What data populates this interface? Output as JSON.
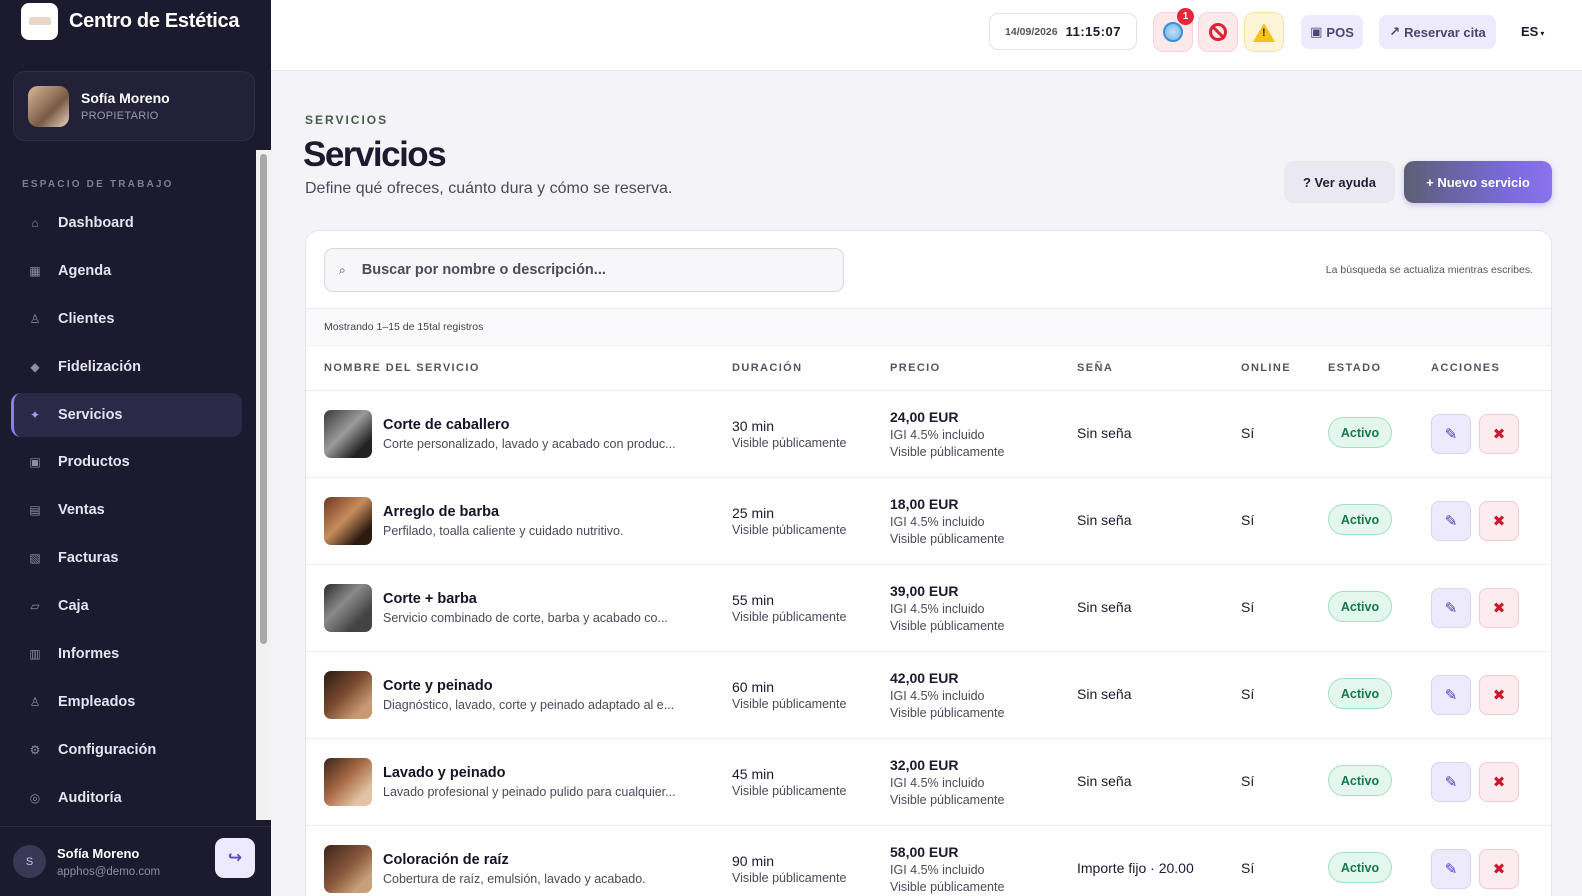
{
  "sidebar": {
    "brand": "Centro de Estética",
    "profile": {
      "name": "Sofía Moreno",
      "role": "PROPIETARIO"
    },
    "caption": "ESPACIO DE TRABAJO",
    "items": [
      {
        "label": "Dashboard",
        "icon": "⌂"
      },
      {
        "label": "Agenda",
        "icon": "▦"
      },
      {
        "label": "Clientes",
        "icon": "♙"
      },
      {
        "label": "Fidelización",
        "icon": "◆"
      },
      {
        "label": "Servicios",
        "icon": "✦"
      },
      {
        "label": "Productos",
        "icon": "▣"
      },
      {
        "label": "Ventas",
        "icon": "▤"
      },
      {
        "label": "Facturas",
        "icon": "▧"
      },
      {
        "label": "Caja",
        "icon": "▱"
      },
      {
        "label": "Informes",
        "icon": "▥"
      },
      {
        "label": "Empleados",
        "icon": "♙"
      },
      {
        "label": "Configuración",
        "icon": "⚙"
      },
      {
        "label": "Auditoría",
        "icon": "◎"
      }
    ],
    "footer": {
      "initial": "S",
      "name": "Sofía Moreno",
      "email": "apphos@demo.com",
      "logout_icon": "↪"
    }
  },
  "header": {
    "date": "14/09/2026",
    "time": "11:15:07",
    "notification_count": "1",
    "pos_label": "POS",
    "pos_icon": "▣",
    "reservar_label": "Reservar cita",
    "reservar_icon": "↗",
    "language": "ES",
    "language_arrow": "▾"
  },
  "page": {
    "eyebrow": "SERVICIOS",
    "title": "Servicios",
    "subtitle": "Define qué ofreces, cuánto dura y cómo se reserva.",
    "help_label": "? Ver ayuda",
    "new_label": "+ Nuevo servicio"
  },
  "table": {
    "search_placeholder": "Buscar por nombre o descripción...",
    "search_icon": "⌕",
    "search_hint": "La búsqueda se actualiza mientras escribes.",
    "count_text": "Mostrando 1–15 de 15tal registros",
    "columns": [
      "NOMBRE DEL SERVICIO",
      "DURACIÓN",
      "PRECIO",
      "SEÑA",
      "ONLINE",
      "ESTADO",
      "ACCIONES"
    ],
    "rows": [
      {
        "name": "Corte de caballero",
        "desc": "Corte personalizado, lavado y acabado con produc...",
        "duration": "30 min",
        "dur_vis": "Visible públicamente",
        "price": "24,00 EUR",
        "tax": "IGI 4.5% incluido",
        "price_vis": "Visible públicamente",
        "sena": "Sin seña",
        "online": "Sí",
        "status": "Activo"
      },
      {
        "name": "Arreglo de barba",
        "desc": "Perfilado, toalla caliente y cuidado nutritivo.",
        "duration": "25 min",
        "dur_vis": "Visible públicamente",
        "price": "18,00 EUR",
        "tax": "IGI 4.5% incluido",
        "price_vis": "Visible públicamente",
        "sena": "Sin seña",
        "online": "Sí",
        "status": "Activo"
      },
      {
        "name": "Corte + barba",
        "desc": "Servicio combinado de corte, barba y acabado co...",
        "duration": "55 min",
        "dur_vis": "Visible públicamente",
        "price": "39,00 EUR",
        "tax": "IGI 4.5% incluido",
        "price_vis": "Visible públicamente",
        "sena": "Sin seña",
        "online": "Sí",
        "status": "Activo"
      },
      {
        "name": "Corte y peinado",
        "desc": "Diagnóstico, lavado, corte y peinado adaptado al e...",
        "duration": "60 min",
        "dur_vis": "Visible públicamente",
        "price": "42,00 EUR",
        "tax": "IGI 4.5% incluido",
        "price_vis": "Visible públicamente",
        "sena": "Sin seña",
        "online": "Sí",
        "status": "Activo"
      },
      {
        "name": "Lavado y peinado",
        "desc": "Lavado profesional y peinado pulido para cualquier...",
        "duration": "45 min",
        "dur_vis": "Visible públicamente",
        "price": "32,00 EUR",
        "tax": "IGI 4.5% incluido",
        "price_vis": "Visible públicamente",
        "sena": "Sin seña",
        "online": "Sí",
        "status": "Activo"
      },
      {
        "name": "Coloración de raíz",
        "desc": "Cobertura de raíz, emulsión, lavado y acabado.",
        "duration": "90 min",
        "dur_vis": "Visible públicamente",
        "price": "58,00 EUR",
        "tax": "IGI 4.5% incluido",
        "price_vis": "Visible públicamente",
        "sena": "Importe fijo · 20.00",
        "online": "Sí",
        "status": "Activo"
      }
    ],
    "edit_icon": "✎",
    "delete_icon": "✖"
  }
}
